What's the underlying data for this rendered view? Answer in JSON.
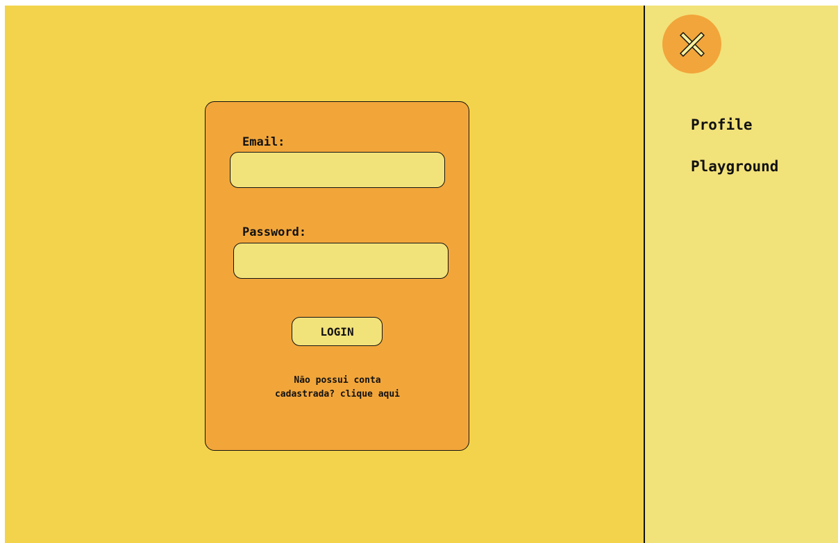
{
  "login_form": {
    "email_label": "Email:",
    "email_value": "",
    "password_label": "Password:",
    "password_value": "",
    "login_button": "LOGIN",
    "signup_prompt_line1": "Não possui conta",
    "signup_prompt_line2": "cadastrada?",
    "signup_link": "clique aqui"
  },
  "sidebar": {
    "close_icon": "close-icon",
    "items": [
      {
        "label": "Profile"
      },
      {
        "label": "Playground"
      }
    ]
  },
  "colors": {
    "main_background": "#f3d34b",
    "card_background": "#f2a63a",
    "sidebar_background": "#f2e27a",
    "input_background": "#f2e27a",
    "close_button": "#f2a53a"
  }
}
